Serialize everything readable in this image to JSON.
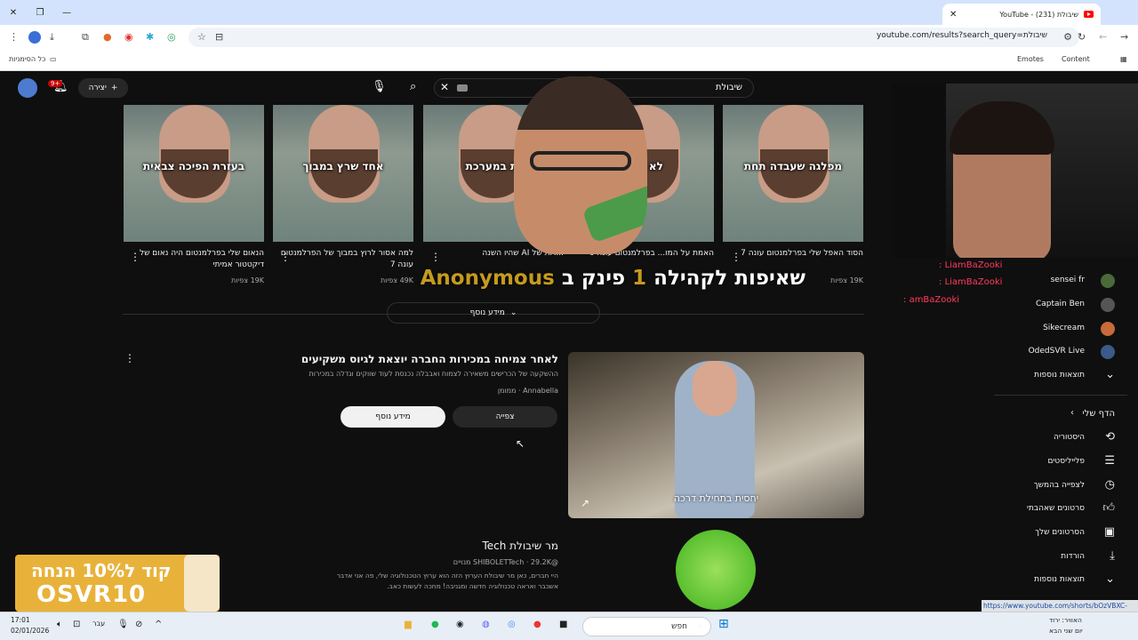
{
  "browser": {
    "tab_title": "YouTube - (231) שיבולת",
    "url": "youtube.com/results?search_query=שיבולת",
    "bookmarks_all": "כל הסימניות",
    "bookmark_emotes": "Emotes",
    "bookmark_content": "Content",
    "status_link": "https://www.youtube.com/shorts/bOzVBXC-KYA"
  },
  "masthead": {
    "search_value": "שיבולת",
    "create_label": "יצירה",
    "notif_count": "9+"
  },
  "shorts": [
    {
      "caption": "מפלגה שעבדה תחת",
      "title": "הסוד האפל שלי בפרלמנטום עונה 7",
      "views": "19K צפיות"
    },
    {
      "caption": "לא הייה",
      "title": "האמת על המו... בפרלמנטום עונה 6",
      "views": ""
    },
    {
      "caption": "ות במערכת",
      "title": "...ויות של AI שהיו השנה",
      "views": ""
    },
    {
      "caption": "אחד שרץ במבוך",
      "title": "למה אסור לרוץ במבוך של הפרלמנטום עונה 7",
      "views": "49K צפיות"
    },
    {
      "caption": "בעזרת הפיכה צבאית",
      "title": "הנאום שלי בפרלמנטום היה נאום של דיקטטור אמיתי",
      "views": "19K צפיות"
    }
  ],
  "overlay": {
    "banner_prefix": "פינק ב",
    "banner_number": "1",
    "banner_suffix": "שאיפות לקהילה",
    "banner_name": "Anonymous"
  },
  "more_button": "מידע נוסף",
  "ad": {
    "title": "לאחר צמיחה במכירות החברה יוצאת לגיוס משקיעים",
    "description": "ההשקעה של הכרישים משאירה לצמוח ואבבלה נכנסת לעוד שווקים וגדלה במכירות",
    "sponsor": "Annabella · ממומן",
    "watch_label": "צפייה",
    "more_label": "מידע נוסף",
    "thumb_caption": "יחסית בתחילת דרכה"
  },
  "channel": {
    "name": "מר שיבולת Tech",
    "meta": "@SHIBOLETTech · 29.2K מנויים",
    "desc": "היי חברים, כאן מר שיבולת הערוץ הזה הוא ערוץ הטכנולוגיה שלי, פה אני אדבר אשכבר ואראה טכנולוגיה חדשה ומגניבה! מחכה לעשות כאב."
  },
  "promo": {
    "line1": "קוד ל10% הנחה",
    "line2": "OSVR10"
  },
  "chat": [
    "LiamBaZooki :",
    "LiamBaZooki :",
    "amBaZooki :"
  ],
  "sidebar": {
    "subs": [
      {
        "label": "sensei fr"
      },
      {
        "label": "Captain Ben"
      },
      {
        "label": "Sikecream"
      },
      {
        "label": "OdedSVR Live"
      }
    ],
    "show_more": "תוצאות נוספות",
    "you_header": "הדף שלי",
    "items": [
      {
        "label": "היסטוריה",
        "icon": "history-icon"
      },
      {
        "label": "פלייליסטים",
        "icon": "playlist-icon"
      },
      {
        "label": "לצפייה בהמשך",
        "icon": "clock-icon"
      },
      {
        "label": "סרטונים שאהבתי",
        "icon": "like-icon"
      },
      {
        "label": "הסרטונים שלך",
        "icon": "video-icon"
      },
      {
        "label": "הורדות",
        "icon": "download-icon"
      }
    ],
    "show_more2": "תוצאות נוספות"
  },
  "taskbar": {
    "search_placeholder": "חפש",
    "time": "17:01",
    "date": "02/01/2026",
    "weather": "האוויר: ירוד",
    "weather2": "יום שני הבא",
    "lang": "עבר"
  }
}
